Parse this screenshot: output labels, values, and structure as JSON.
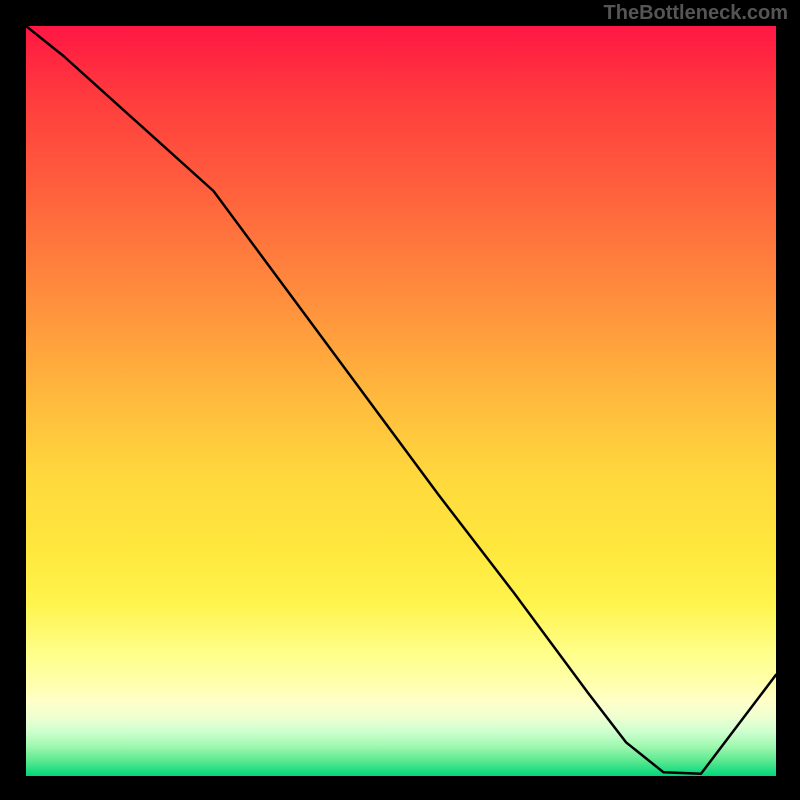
{
  "watermark": "TheBottleneck.com",
  "chart_data": {
    "type": "line",
    "x": [
      0.0,
      0.05,
      0.15,
      0.25,
      0.35,
      0.45,
      0.55,
      0.65,
      0.75,
      0.8,
      0.85,
      0.9,
      1.0
    ],
    "y": [
      1.0,
      0.96,
      0.87,
      0.78,
      0.645,
      0.51,
      0.375,
      0.245,
      0.11,
      0.045,
      0.005,
      0.003,
      0.135
    ],
    "xlabel": "",
    "ylabel": "",
    "xlim": [
      0,
      1
    ],
    "ylim": [
      0,
      1
    ],
    "background": "red-yellow-green vertical gradient",
    "annotation": {
      "text": "",
      "x": 0.82,
      "y": 0.005
    }
  }
}
